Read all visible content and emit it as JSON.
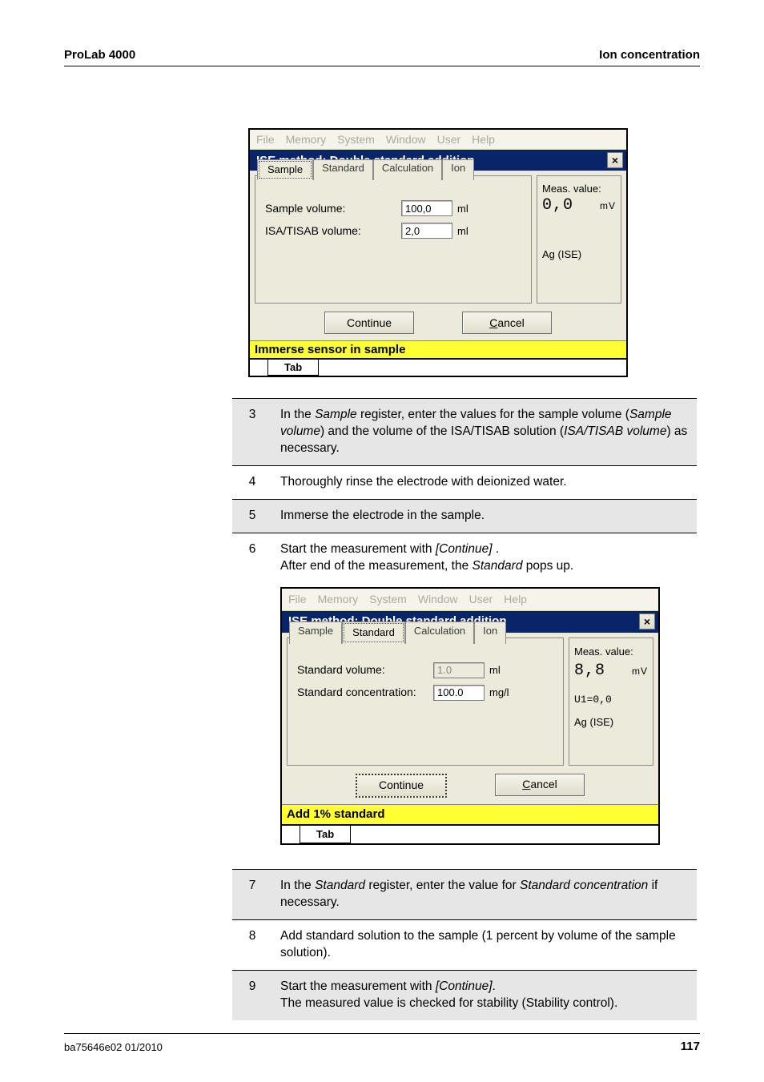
{
  "header": {
    "left": "ProLab 4000",
    "right": "Ion concentration"
  },
  "menu": {
    "file": "File",
    "memory": "Memory",
    "system": "System",
    "window": "Window",
    "user": "User",
    "help": "Help"
  },
  "win1": {
    "title": "ISE method:  Double standard addition",
    "tabs": {
      "sample": "Sample",
      "standard": "Standard",
      "calculation": "Calculation",
      "ion": "Ion"
    },
    "rows": {
      "sample_volume_label": "Sample volume:",
      "sample_volume_value": "100,0",
      "sample_volume_unit": "ml",
      "isa_volume_label": "ISA/TISAB volume:",
      "isa_volume_value": "2,0",
      "isa_volume_unit": "ml"
    },
    "side": {
      "meas_label": "Meas. value:",
      "meas_value": "0,0",
      "meas_unit": "mV",
      "ag": "Ag (ISE)"
    },
    "buttons": {
      "continue": "Continue",
      "cancel": "Cancel",
      "cancel_html": "C"
    },
    "status": "Immerse sensor in sample",
    "outer_tab": "Tab"
  },
  "steps_a": {
    "3": "In the <i>Sample</i> register, enter the values for the sample volume (<i>Sample volume</i>) and the volume of the ISA/TISAB solution (<i>ISA/TISAB volume</i>) as necessary.",
    "4": "Thoroughly rinse the electrode with deionized water.",
    "5": "Immerse the electrode in the sample.",
    "6a": "Start the measurement with <i>[Continue]</i> .",
    "6b": "After end of the measurement, the <i>Standard</i> pops up."
  },
  "win2": {
    "title": "ISE method:  Double standard addition",
    "rows": {
      "std_volume_label": "Standard volume:",
      "std_volume_value": "1.0",
      "std_volume_unit": "ml",
      "std_conc_label": "Standard concentration:",
      "std_conc_value": "100.0",
      "std_conc_unit": "mg/l"
    },
    "side": {
      "meas_label": "Meas. value:",
      "meas_value": "8,8",
      "meas_unit": "mV",
      "u1": "U1=0,0",
      "ag": "Ag (ISE)"
    },
    "buttons": {
      "continue": "Continue",
      "cancel": "Cancel"
    },
    "status": "Add 1% standard",
    "outer_tab": "Tab"
  },
  "steps_b": {
    "7": "In the <i>Standard</i> register, enter the value for <i>Standard concentration</i> if necessary.",
    "8": "Add standard solution to the sample (1 percent by volume of the sample solution).",
    "9a": "Start the measurement with <i>[Continue]</i>.",
    "9b": "The measured value is checked for stability (Stability control)."
  },
  "footer": {
    "left": "ba75646e02      01/2010",
    "page": "117"
  }
}
